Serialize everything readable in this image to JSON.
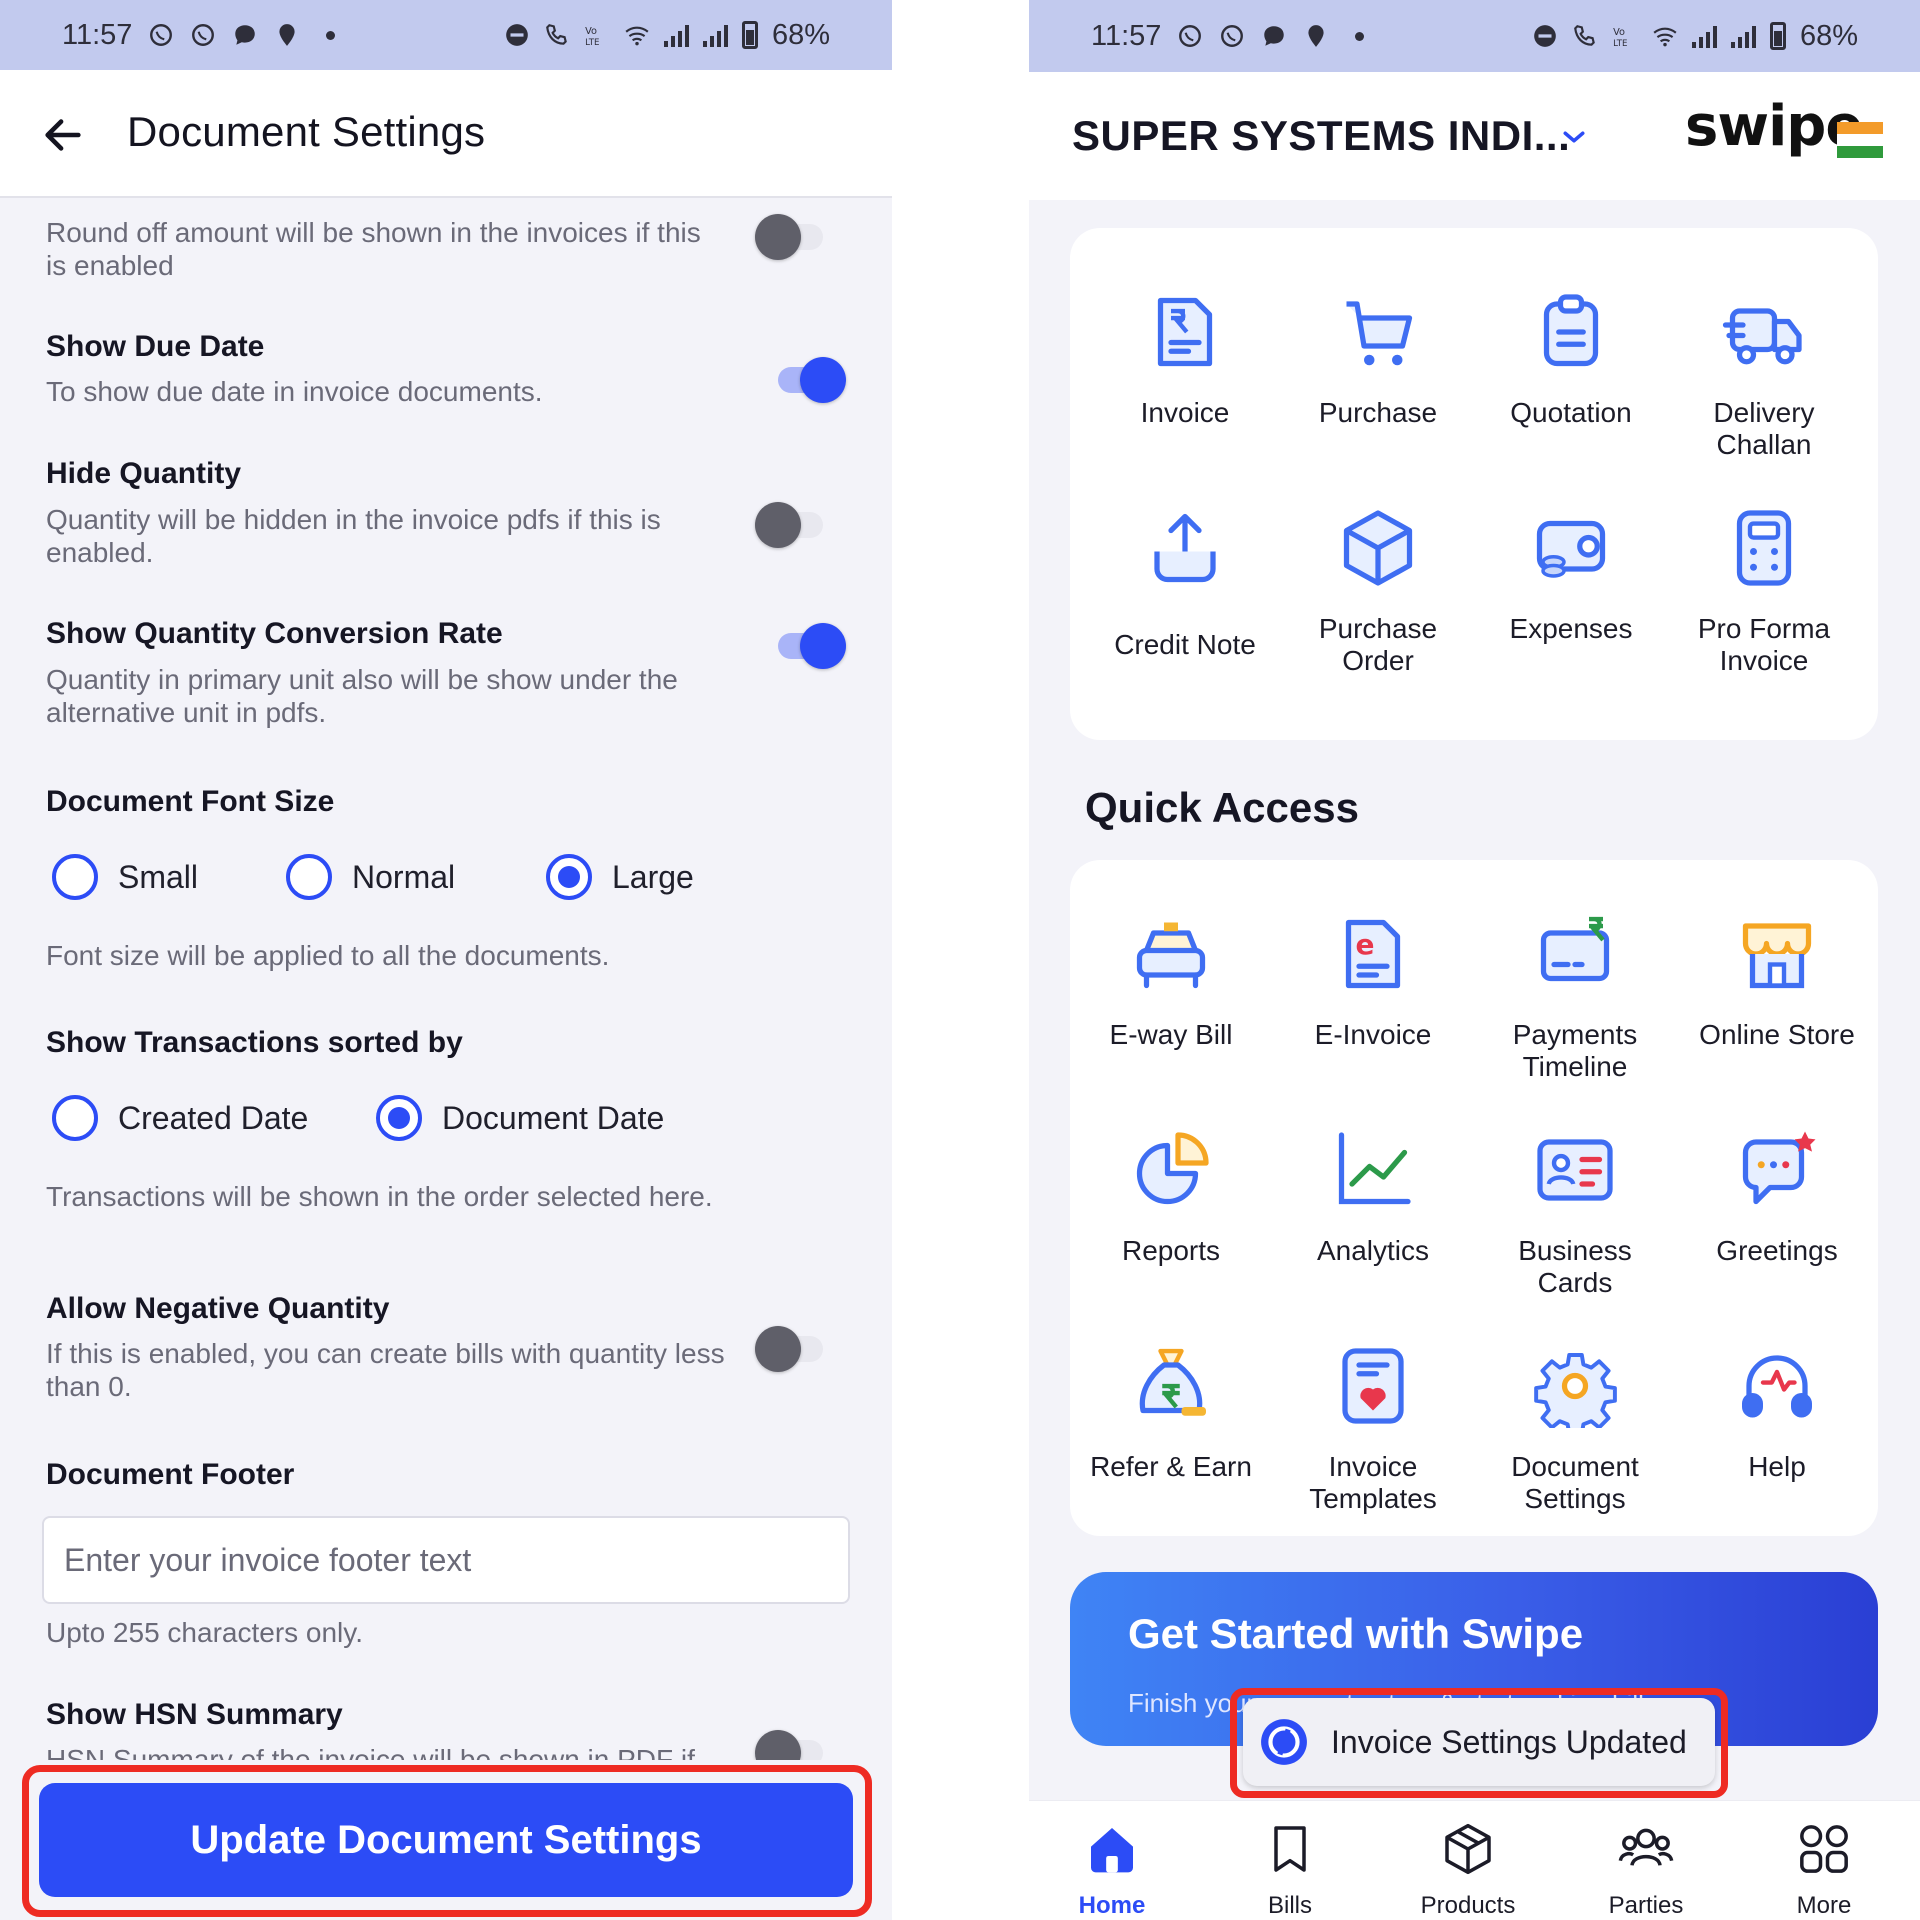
{
  "status_bar": {
    "time": "11:57",
    "battery": "68%"
  },
  "left": {
    "title": "Document Settings",
    "settings": [
      {
        "title": "",
        "desc": "Round off amount will be shown in the invoices if this is enabled",
        "enabled": false
      },
      {
        "title": "Show Due Date",
        "desc": "To show due date in invoice documents.",
        "enabled": true
      },
      {
        "title": "Hide Quantity",
        "desc": "Quantity will be hidden in the invoice pdfs if this is enabled.",
        "enabled": false
      },
      {
        "title": "Show Quantity Conversion Rate",
        "desc": "Quantity in primary unit also will be show under the alternative unit in pdfs.",
        "enabled": true
      }
    ],
    "font_size": {
      "title": "Document Font Size",
      "options": [
        "Small",
        "Normal",
        "Large"
      ],
      "selected": "Large",
      "note": "Font size will be applied to all the documents."
    },
    "sort": {
      "title": "Show Transactions sorted by",
      "options": [
        "Created Date",
        "Document Date"
      ],
      "selected": "Document Date",
      "note": "Transactions will be shown in the order selected here."
    },
    "negative": {
      "title": "Allow Negative Quantity",
      "desc": "If this is enabled, you can create bills with quantity less than 0.",
      "enabled": false
    },
    "footer": {
      "title": "Document Footer",
      "placeholder": "Enter your invoice footer text",
      "value": "",
      "note": "Upto 255 characters only."
    },
    "hsn": {
      "title": "Show HSN Summary",
      "desc": "HSN Summary of the invoice will be shown in PDF if",
      "enabled": false
    },
    "update_button": "Update Document Settings"
  },
  "right": {
    "company": "SUPER SYSTEMS INDI...",
    "brand": "swipe",
    "documents": [
      {
        "label": "Invoice",
        "icon": "invoice-icon"
      },
      {
        "label": "Purchase",
        "icon": "cart-icon"
      },
      {
        "label": "Quotation",
        "icon": "clipboard-icon"
      },
      {
        "label": "Delivery Challan",
        "icon": "truck-icon"
      },
      {
        "label": "Credit Note",
        "icon": "upload-icon"
      },
      {
        "label": "Purchase Order",
        "icon": "box-icon"
      },
      {
        "label": "Expenses",
        "icon": "wallet-icon"
      },
      {
        "label": "Pro Forma Invoice",
        "icon": "calculator-icon"
      }
    ],
    "quick_access_title": "Quick Access",
    "quick_access": [
      {
        "label": "E-way Bill",
        "icon": "car-icon"
      },
      {
        "label": "E-Invoice",
        "icon": "e-invoice-icon"
      },
      {
        "label": "Payments Timeline",
        "icon": "payment-card-icon"
      },
      {
        "label": "Online Store",
        "icon": "store-icon"
      },
      {
        "label": "Reports",
        "icon": "pie-chart-icon"
      },
      {
        "label": "Analytics",
        "icon": "line-chart-icon"
      },
      {
        "label": "Business Cards",
        "icon": "id-card-icon"
      },
      {
        "label": "Greetings",
        "icon": "greeting-chat-icon"
      },
      {
        "label": "Refer & Earn",
        "icon": "money-bag-icon"
      },
      {
        "label": "Invoice Templates",
        "icon": "template-heart-icon"
      },
      {
        "label": "Document Settings",
        "icon": "settings-gear-icon"
      },
      {
        "label": "Help",
        "icon": "headset-icon"
      }
    ],
    "banner": {
      "title": "Get Started with Swipe",
      "subtitle": "Finish your account set up & start making bills."
    },
    "toast": "Invoice Settings Updated",
    "nav": [
      {
        "label": "Home",
        "icon": "home-icon",
        "active": true
      },
      {
        "label": "Bills",
        "icon": "bookmark-icon",
        "active": false
      },
      {
        "label": "Products",
        "icon": "box-icon",
        "active": false
      },
      {
        "label": "Parties",
        "icon": "people-icon",
        "active": false
      },
      {
        "label": "More",
        "icon": "grid-icon",
        "active": false
      }
    ]
  },
  "colors": {
    "accent": "#2c4cf6",
    "highlight": "#ee2b23",
    "status_bar": "#c2caee",
    "background": "#f3f3f9"
  }
}
